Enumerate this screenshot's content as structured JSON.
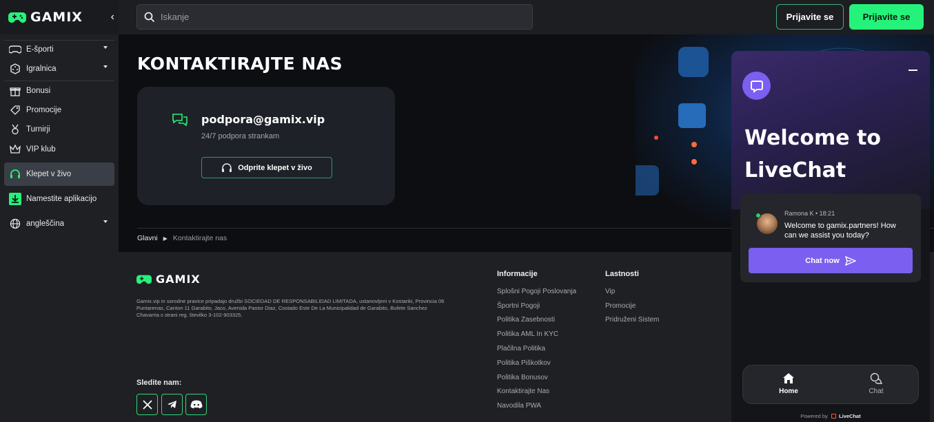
{
  "brand": {
    "name": "GAMIX",
    "accent": "#25f27a"
  },
  "sidebar": {
    "items": [
      {
        "label": "E-športi",
        "icon": "gamepad-icon",
        "expandable": true
      },
      {
        "label": "Igralnica",
        "icon": "dice-icon",
        "expandable": true
      },
      {
        "label": "Bonusi",
        "icon": "gift-icon",
        "expandable": false
      },
      {
        "label": "Promocije",
        "icon": "tag-icon",
        "expandable": false
      },
      {
        "label": "Turnirji",
        "icon": "medal-icon",
        "expandable": false
      },
      {
        "label": "VIP klub",
        "icon": "crown-icon",
        "expandable": false
      },
      {
        "label": "Klepet v živo",
        "icon": "headset-icon",
        "expandable": false,
        "active": true
      },
      {
        "label": "Namestite aplikacijo",
        "icon": "download-icon",
        "expandable": false
      },
      {
        "label": "angleščina",
        "icon": "globe-icon",
        "expandable": true
      }
    ]
  },
  "topbar": {
    "search_placeholder": "Iskanje",
    "login_label": "Prijavite se",
    "register_label": "Prijavite se"
  },
  "hero": {
    "title": "KONTAKTIRAJTE NAS",
    "contact": {
      "email": "podpora@gamix.vip",
      "subtitle": "24/7 podpora strankam",
      "button_label": "Odprite klepet v živo"
    },
    "breadcrumb": [
      "Glavni",
      "Kontaktirajte nas"
    ]
  },
  "footer": {
    "legal_text": "Gamix.vip in sorodne pravice pripadajo družbi SOCIEDAD DE RESPONSABILIDAD LIMITADA, ustanovljeni v Kostariki, Provincia 06 Puntarenas, Canton 11 Garabito, Jaco, Avenida Pastor Diaz, Costado Este De La Municipalidad de Garabito, Bufete Sanchez Chavarria s strani reg. številko 3-102-903325.",
    "follow_label": "Sledite nam:",
    "social": [
      "x-icon",
      "telegram-icon",
      "discord-icon"
    ],
    "columns": [
      {
        "title": "Informacije",
        "links": [
          "Splošni Pogoji Poslovanja",
          "Športni Pogoji",
          "Politika Zasebnosti",
          "Politika AML In KYC",
          "Plačilna Politika",
          "Politika Piškotkov",
          "Politika Bonusov",
          "Kontaktirajte Nas",
          "Navodila PWA"
        ]
      },
      {
        "title": "Lastnosti",
        "links": [
          "Vip",
          "Promocije",
          "Pridruženi Sistem"
        ]
      }
    ]
  },
  "livechat": {
    "welcome": "Welcome to LiveChat",
    "agent_meta": "Ramona K • 18:21",
    "message": "Welcome to gamix.partners! How can we assist you today?",
    "chat_now_label": "Chat now",
    "tabs": [
      {
        "label": "Home",
        "icon": "home-icon",
        "active": true
      },
      {
        "label": "Chat",
        "icon": "chat-bubbles-icon",
        "active": false
      }
    ],
    "powered_prefix": "Powered by",
    "powered_brand": "LiveChat",
    "accent": "#7b5ff0"
  }
}
